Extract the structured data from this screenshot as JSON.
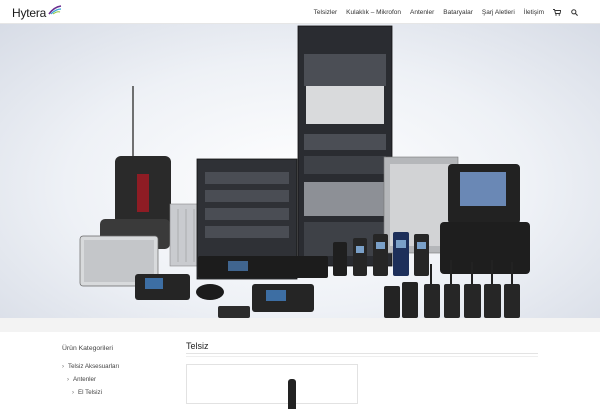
{
  "brand": {
    "logo_text": "Hytera"
  },
  "nav": {
    "items": [
      "Telsizler",
      "Kulaklık – Mikrofon",
      "Antenler",
      "Bataryalar",
      "Şarj Aletleri",
      "İletişim"
    ],
    "cart_icon": "cart-icon",
    "search_icon": "search-icon"
  },
  "hero": {
    "image": "hytera-product-lineup"
  },
  "sidebar": {
    "title": "Ürün Kategorileri",
    "items": [
      {
        "label": "Telsiz Aksesuarları",
        "level": 0
      },
      {
        "label": "Antenler",
        "level": 1
      },
      {
        "label": "El Telsizi",
        "level": 2
      }
    ]
  },
  "main": {
    "title": "Telsiz"
  },
  "colors": {
    "text": "#333333",
    "rule": "#e3e3e3",
    "strip": "#f3f3f3",
    "logo_accent": "#6a2c8e"
  }
}
